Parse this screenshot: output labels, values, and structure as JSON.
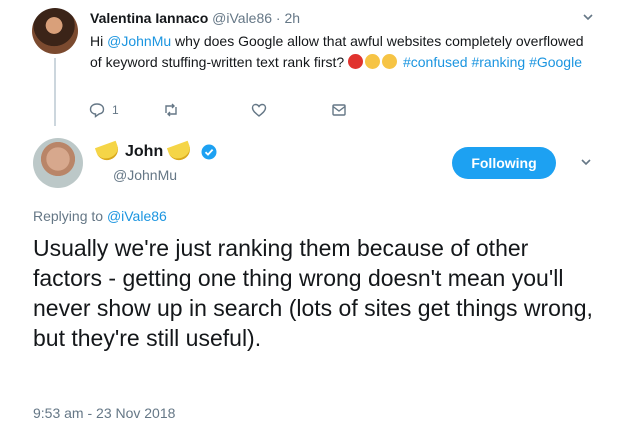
{
  "parent_tweet": {
    "author_name": "Valentina Iannaco",
    "author_handle": "@iVale86",
    "time": "2h",
    "text_before": "Hi ",
    "mention": "@JohnMu",
    "text_after": " why does Google allow that awful websites completely overflowed of keyword stuffing-written text rank first? ",
    "emojis": [
      "angry-face",
      "weary-face",
      "weary-face"
    ],
    "hashtags": [
      "#confused",
      "#ranking",
      "#Google"
    ],
    "reply_count": "1",
    "icons": [
      "reply-icon",
      "retweet-icon",
      "like-icon",
      "direct-message-icon"
    ]
  },
  "main_tweet": {
    "author_name": "John",
    "author_handle": "@JohnMu",
    "follow_label": "Following",
    "replying_prefix": "Replying to ",
    "replying_handle": "@iVale86",
    "text": "Usually we're just ranking them because of other factors - getting one thing wrong doesn't mean you'll never show up in search (lots of sites get things wrong, but they're still useful).",
    "timestamp": "9:53 am - 23 Nov 2018"
  },
  "colors": {
    "link": "#1b95e0",
    "follow_button": "#1da1f2",
    "muted_text": "#657786",
    "verified_badge": "#1da1f2"
  }
}
